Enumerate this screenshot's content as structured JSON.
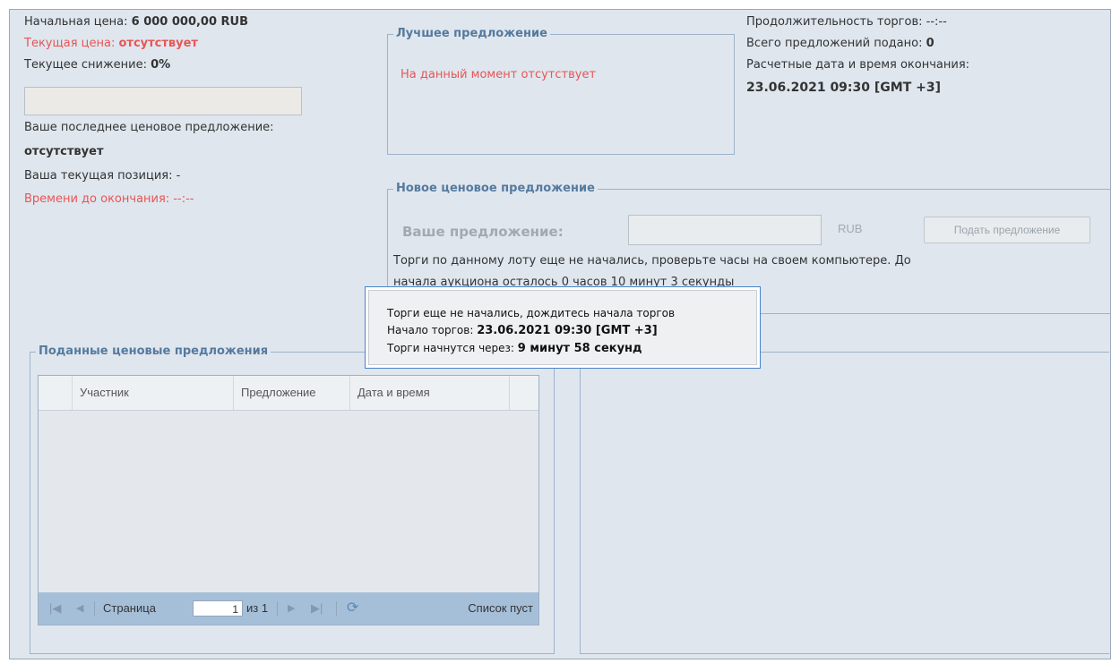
{
  "info": {
    "start_price_label": "Начальная цена:",
    "start_price_value": "6 000 000,00 RUB",
    "current_price_label": "Текущая цена:",
    "current_price_value": "отсутствует",
    "current_decrease_label": "Текущее снижение:",
    "current_decrease_value": "0%",
    "last_bid_label": "Ваше последнее ценовое предложение:",
    "last_bid_value": "отсутствует",
    "position_label": "Ваша текущая позиция: -",
    "time_left_label": "Времени до окончания: --:--"
  },
  "best_offer": {
    "title": "Лучшее предложение",
    "text": "На данный момент отсутствует"
  },
  "stats": {
    "duration_label": "Продолжительность торгов: --:--",
    "total_bids_label": "Всего предложений подано:",
    "total_bids_value": "0",
    "end_label": "Расчетные дата и время окончания:",
    "end_value": "23.06.2021 09:30 [GMT +3]"
  },
  "new_bid": {
    "title": "Новое ценовое предложение",
    "your_offer_label": "Ваше предложение:",
    "currency": "RUB",
    "submit_label": "Подать предложение",
    "notice_line1": "Торги по данному лоту еще не начались, проверьте часы на своем компьютере. До",
    "notice_line2": "начала аукциона осталось 0 часов 10 минут 3 секунды"
  },
  "tooltip": {
    "line1": "Торги еще не начались, дождитесь начала торгов",
    "start_label": "Начало торгов:",
    "start_value": "23.06.2021 09:30 [GMT +3]",
    "countdown_label": "Торги начнутся через:",
    "countdown_value": "9 минут 58 секунд"
  },
  "bids": {
    "title": "Поданные ценовые предложения",
    "columns": [
      "Участник",
      "Предложение",
      "Дата и время"
    ],
    "pager": {
      "page_label": "Страница",
      "page_value": "1",
      "of_label": "из 1",
      "status": "Список пуст"
    }
  },
  "icons": {
    "first": "first-page-icon",
    "prev": "prev-page-icon",
    "next": "next-page-icon",
    "last": "last-page-icon",
    "refresh": "refresh-icon"
  }
}
